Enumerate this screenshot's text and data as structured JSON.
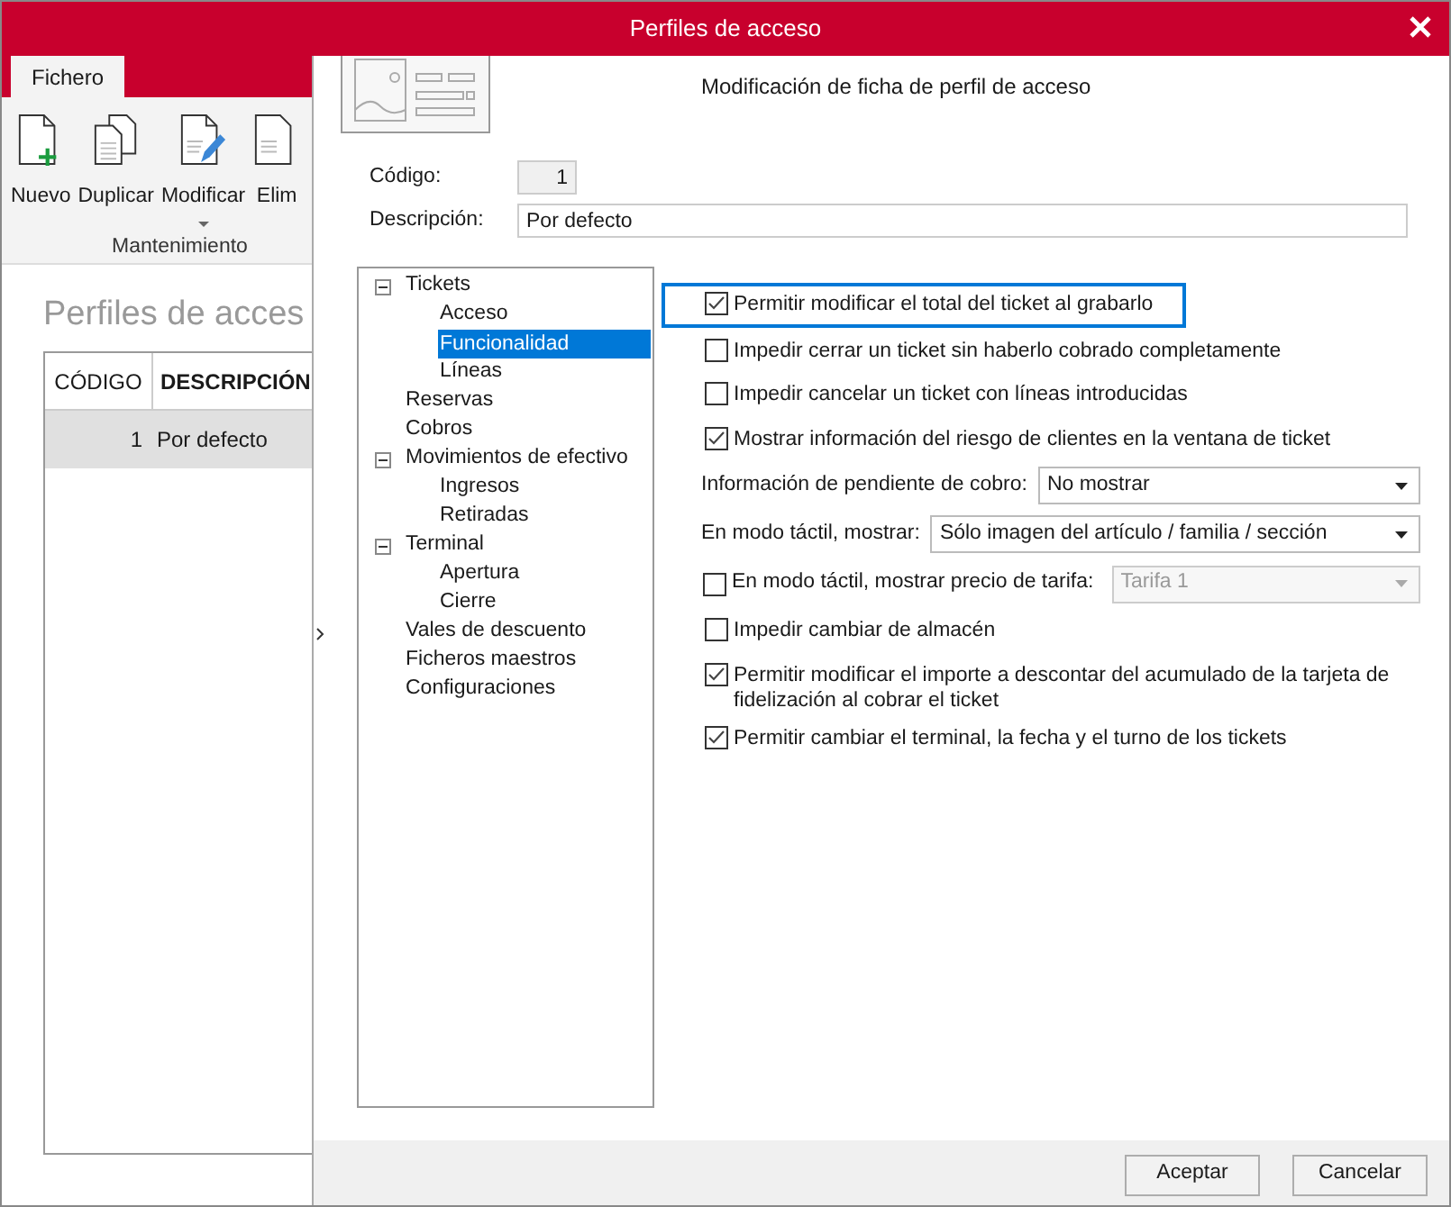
{
  "window": {
    "title": "Perfiles de acceso"
  },
  "app": {
    "tabs": [
      {
        "label": "Fichero",
        "selected": true
      }
    ],
    "ribbon_buttons": [
      {
        "label": "Nuevo",
        "dropdown": false
      },
      {
        "label": "Duplicar",
        "dropdown": false
      },
      {
        "label": "Modificar",
        "dropdown": true
      },
      {
        "label": "Elim",
        "dropdown": false
      }
    ],
    "ribbon_group": "Mantenimiento",
    "heading": "Perfiles de acces",
    "table": {
      "columns": [
        "CÓDIGO",
        "DESCRIPCIÓN"
      ],
      "rows": [
        {
          "cells": [
            "1",
            "Por defecto"
          ],
          "selected": true
        }
      ]
    }
  },
  "dialog": {
    "title": "Modificación de ficha de perfil de acceso",
    "fields": [
      {
        "label": "Código:",
        "value": "1",
        "kind": "code"
      },
      {
        "label": "Descripción:",
        "value": "Por defecto",
        "kind": "text"
      }
    ],
    "tree": [
      {
        "label": "Tickets",
        "expanded": true,
        "selected": false,
        "children": [
          {
            "label": "Acceso",
            "selected": false
          },
          {
            "label": "Funcionalidad",
            "selected": true
          },
          {
            "label": "Líneas",
            "selected": false
          }
        ]
      },
      {
        "label": "Reservas",
        "selected": false
      },
      {
        "label": "Cobros",
        "selected": false
      },
      {
        "label": "Movimientos de efectivo",
        "expanded": true,
        "selected": false,
        "children": [
          {
            "label": "Ingresos",
            "selected": false
          },
          {
            "label": "Retiradas",
            "selected": false
          }
        ]
      },
      {
        "label": "Terminal",
        "expanded": true,
        "selected": false,
        "children": [
          {
            "label": "Apertura",
            "selected": false
          },
          {
            "label": "Cierre",
            "selected": false
          }
        ]
      },
      {
        "label": "Vales de descuento",
        "selected": false
      },
      {
        "label": "Ficheros maestros",
        "selected": false
      },
      {
        "label": "Configuraciones",
        "selected": false
      }
    ],
    "options": [
      {
        "kind": "checkbox",
        "label": "Permitir modificar el total del ticket al grabarlo",
        "checked": true,
        "focused": true
      },
      {
        "kind": "checkbox",
        "label": "Impedir cerrar un ticket sin haberlo cobrado completamente",
        "checked": false,
        "focused": false
      },
      {
        "kind": "checkbox",
        "label": "Impedir cancelar un ticket con líneas introducidas",
        "checked": false,
        "focused": false
      },
      {
        "kind": "checkbox",
        "label": "Mostrar información del riesgo de clientes en la ventana de ticket",
        "checked": true,
        "focused": false
      },
      {
        "kind": "select",
        "label": "Información de pendiente de cobro:",
        "value": "No mostrar",
        "disabled": false
      },
      {
        "kind": "select",
        "label": "En modo táctil, mostrar:",
        "value": "Sólo imagen del artículo / familia / sección",
        "disabled": false
      },
      {
        "kind": "checkbox_select",
        "label": "En modo táctil, mostrar precio de tarifa:",
        "checked": false,
        "value": "Tarifa 1",
        "disabled": true
      },
      {
        "kind": "checkbox",
        "label": "Impedir cambiar de almacén",
        "checked": false,
        "focused": false
      },
      {
        "kind": "checkbox",
        "label": "Permitir modificar el importe a descontar del acumulado de la tarjeta de fidelización al cobrar el ticket",
        "checked": true,
        "focused": false
      },
      {
        "kind": "checkbox",
        "label": "Permitir cambiar el terminal, la fecha y el turno de los tickets",
        "checked": true,
        "focused": false
      }
    ],
    "buttons": [
      "Aceptar",
      "Cancelar"
    ]
  }
}
